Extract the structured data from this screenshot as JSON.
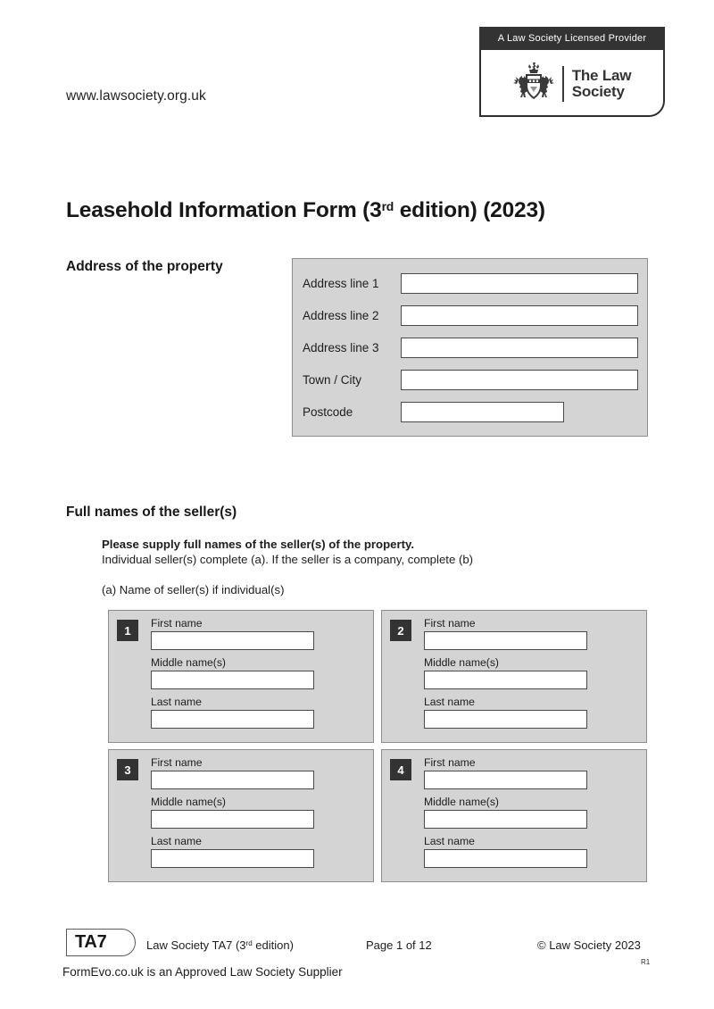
{
  "header": {
    "website": "www.lawsociety.org.uk",
    "logo": {
      "banner_text": "A Law Society Licensed Provider",
      "name_line1": "The Law",
      "name_line2": "Society",
      "crest_icon": "law-society-crest-icon"
    }
  },
  "title": {
    "main": "Leasehold Information Form (3",
    "sup": "rd",
    "rest": " edition) (2023)",
    "full": "Leasehold Information Form (3rd edition) (2023)"
  },
  "address_section": {
    "heading": "Address of the property",
    "fields": [
      {
        "label": "Address line 1",
        "value": "",
        "placeholder": "",
        "short": false
      },
      {
        "label": "Address line 2",
        "value": "",
        "placeholder": "",
        "short": false
      },
      {
        "label": "Address line 3",
        "value": "",
        "placeholder": "",
        "short": false
      },
      {
        "label": "Town / City",
        "value": "",
        "placeholder": "",
        "short": false
      },
      {
        "label": "Postcode",
        "value": "",
        "placeholder": "",
        "short": true
      }
    ]
  },
  "seller_section": {
    "heading": "Full names of the seller(s)",
    "instruction_bold": "Please supply full names of the seller(s) of the property.",
    "instruction_plain": "Individual seller(s) complete (a). If the seller is a company, complete (b)",
    "subheading_a": "(a) Name of seller(s) if individual(s)",
    "field_labels": {
      "first": "First name",
      "middle": "Middle name(s)",
      "last": "Last name"
    },
    "cards": [
      {
        "number": "1",
        "first_name": "",
        "middle_names": "",
        "last_name": ""
      },
      {
        "number": "2",
        "first_name": "",
        "middle_names": "",
        "last_name": ""
      },
      {
        "number": "3",
        "first_name": "",
        "middle_names": "",
        "last_name": ""
      },
      {
        "number": "4",
        "first_name": "",
        "middle_names": "",
        "last_name": ""
      }
    ]
  },
  "footer": {
    "form_code": "TA7",
    "edition_prefix": "Law Society TA7 (3",
    "edition_sup": "rd",
    "edition_suffix": " edition)",
    "page_label": "Page 1 of 12",
    "copyright": "© Law Society 2023",
    "revision": "R1",
    "supplier": "FormEvo.co.uk is an Approved Law Society Supplier"
  },
  "colors": {
    "panel_fill": "#d4d4d4",
    "panel_border": "#8e8e8e",
    "badge_dark": "#333333",
    "input_border": "#4a4a4a",
    "text": "#1d1d1d"
  }
}
